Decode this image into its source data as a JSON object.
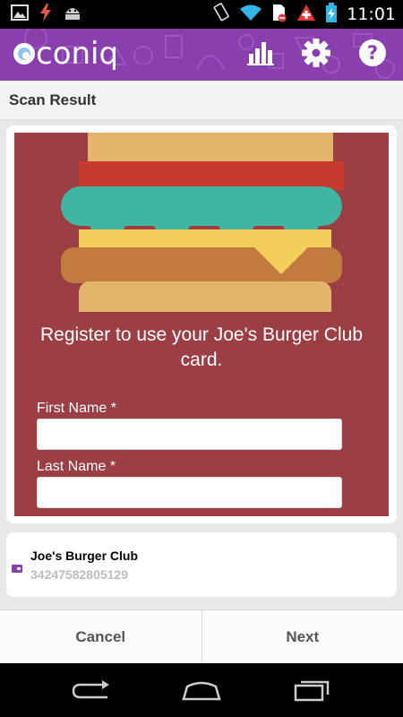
{
  "status_bar": {
    "time": "11:01",
    "icons": [
      "image-icon",
      "flash-icon",
      "android-icon",
      "vibrate-icon",
      "wifi-icon",
      "sim-blocked-icon",
      "swiss-flag-icon",
      "battery-charging-icon"
    ]
  },
  "app_bar": {
    "logo_text": "coniq",
    "actions": [
      "stats-icon",
      "gear-icon",
      "help-icon"
    ]
  },
  "page": {
    "title": "Scan Result"
  },
  "promo": {
    "message": "Register to use your Joe's Burger Club card.",
    "first_name_label": "First Name *",
    "first_name_value": "",
    "last_name_label": "Last Name *",
    "last_name_value": ""
  },
  "card": {
    "name": "Joe's Burger Club",
    "number": "34247582805129"
  },
  "buttons": {
    "cancel": "Cancel",
    "next": "Next"
  },
  "nav": [
    "back-icon",
    "home-icon",
    "recents-icon"
  ],
  "colors": {
    "brand_purple": "#8a3fae",
    "promo_background": "#9b3f45",
    "bun": "#e2b46c",
    "tomato": "#c83a2d",
    "lettuce": "#3fb5a2",
    "cheese": "#f2cd5a",
    "patty": "#c37a3f"
  }
}
